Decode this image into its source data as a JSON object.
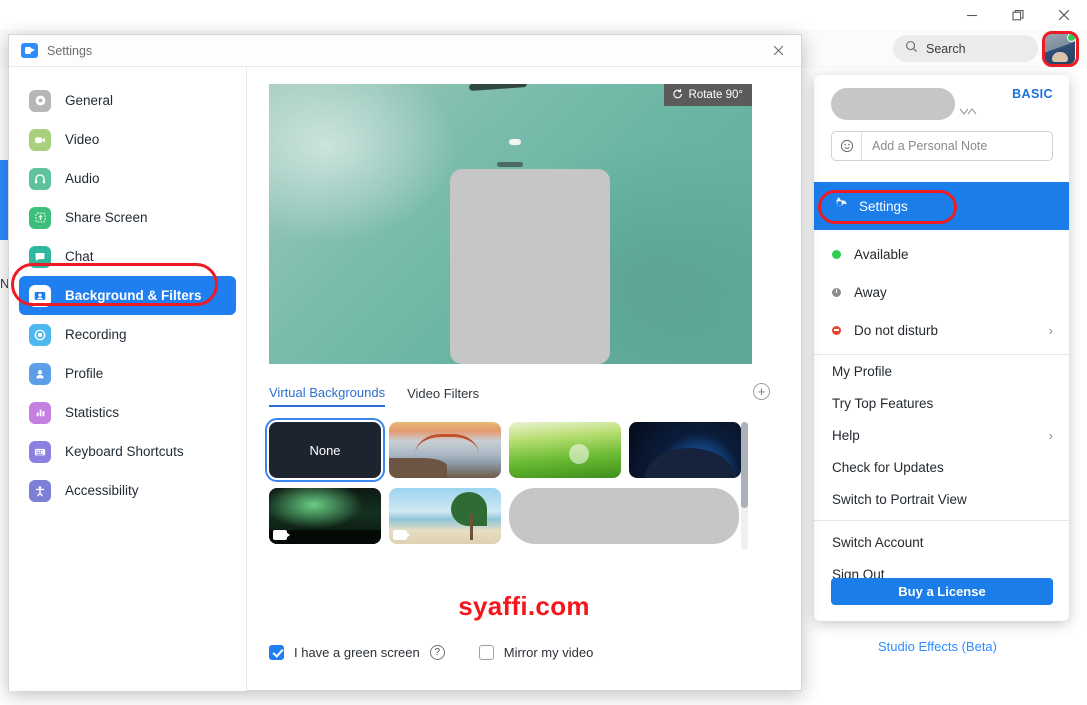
{
  "window": {
    "controls": {
      "minimize": "minimize-icon",
      "restore": "restore-icon",
      "close": "close-icon"
    }
  },
  "topbar": {
    "search_placeholder": "Search",
    "search_icon": "search-icon",
    "avatar_icon": "avatar",
    "presence": "available"
  },
  "profile_panel": {
    "plan_badge": "BASIC",
    "name_redacted": true,
    "personal_note_placeholder": "Add a Personal Note",
    "emoji_icon": "smiley-icon",
    "settings_label": "Settings",
    "settings_icon": "gear-icon",
    "status_items": [
      {
        "label": "Available",
        "dot": "green",
        "chevron": false
      },
      {
        "label": "Away",
        "dot": "clock",
        "chevron": false
      },
      {
        "label": "Do not disturb",
        "dot": "red",
        "chevron": true
      }
    ],
    "links": [
      {
        "label": "My Profile",
        "chevron": false
      },
      {
        "label": "Try Top Features",
        "chevron": false
      },
      {
        "label": "Help",
        "chevron": true
      },
      {
        "label": "Check for Updates",
        "chevron": false
      },
      {
        "label": "Switch to Portrait View",
        "chevron": false
      }
    ],
    "account_links": [
      {
        "label": "Switch Account",
        "chevron": false
      },
      {
        "label": "Sign Out",
        "chevron": false
      }
    ],
    "buy_license_label": "Buy a License"
  },
  "settings_dialog": {
    "title": "Settings",
    "app_icon": "zoom-logo-icon",
    "close_icon": "close-icon",
    "sidebar": [
      {
        "label": "General",
        "icon": "gear-icon",
        "color": "#b6b6b6",
        "active": false
      },
      {
        "label": "Video",
        "icon": "camera-icon",
        "color": "#a8d07f",
        "active": false
      },
      {
        "label": "Audio",
        "icon": "headset-icon",
        "color": "#5ec39a",
        "active": false
      },
      {
        "label": "Share Screen",
        "icon": "share-screen-icon",
        "color": "#3bbf7a",
        "active": false
      },
      {
        "label": "Chat",
        "icon": "chat-bubble-icon",
        "color": "#2fb79f",
        "active": false
      },
      {
        "label": "Background & Filters",
        "icon": "person-card-icon",
        "color": "#1f7ff0",
        "active": true
      },
      {
        "label": "Recording",
        "icon": "record-icon",
        "color": "#4bb8f0",
        "active": false
      },
      {
        "label": "Profile",
        "icon": "person-icon",
        "color": "#5d9ee8",
        "active": false
      },
      {
        "label": "Statistics",
        "icon": "bar-chart-icon",
        "color": "#c47fe0",
        "active": false
      },
      {
        "label": "Keyboard Shortcuts",
        "icon": "keyboard-icon",
        "color": "#8b7fe0",
        "active": false
      },
      {
        "label": "Accessibility",
        "icon": "accessibility-icon",
        "color": "#7b7fd6",
        "active": false
      }
    ],
    "preview": {
      "rotate_label": "Rotate 90°",
      "rotate_icon": "rotate-icon"
    },
    "tabs": [
      {
        "label": "Virtual Backgrounds",
        "active": true
      },
      {
        "label": "Video Filters",
        "active": false
      }
    ],
    "add_button_icon": "plus-circle-icon",
    "backgrounds": [
      {
        "label": "None",
        "kind": "none",
        "selected": true,
        "video": false
      },
      {
        "label": "",
        "kind": "bridge",
        "selected": false,
        "video": false
      },
      {
        "label": "",
        "kind": "grass",
        "selected": false,
        "video": false
      },
      {
        "label": "",
        "kind": "earth",
        "selected": false,
        "video": false
      },
      {
        "label": "",
        "kind": "aurora",
        "selected": false,
        "video": true
      },
      {
        "label": "",
        "kind": "beach",
        "selected": false,
        "video": true
      },
      {
        "label": "",
        "kind": "redacted",
        "selected": false,
        "video": false
      }
    ],
    "green_screen": {
      "label": "I have a green screen",
      "checked": true,
      "help_icon": "question-icon"
    },
    "mirror_video": {
      "label": "Mirror my video",
      "checked": false
    },
    "studio_effects_label": "Studio Effects (Beta)"
  },
  "watermark": {
    "text": "syaffi.com",
    "color": "#f4161b"
  },
  "annotations": {
    "avatar_highlight": "avatar-button",
    "background_filters_highlight": "sidebar-item-background-filters",
    "settings_highlight": "profile-menu-settings"
  }
}
